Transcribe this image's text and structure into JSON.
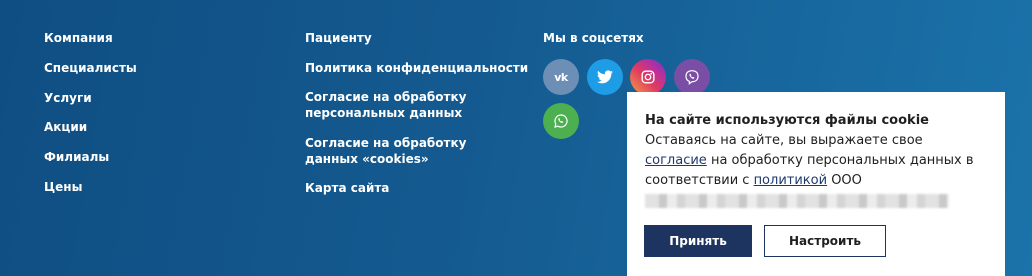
{
  "footer": {
    "company_links": [
      "Компания",
      "Специалисты",
      "Услуги",
      "Акции",
      "Филиалы",
      "Цены"
    ],
    "patient_links": [
      "Пациенту",
      "Политика конфиденциальности",
      "Согласие на обработку персональных данных",
      "Согласие на обработку данных «cookies»",
      "Карта сайта"
    ],
    "social": {
      "heading": "Мы в соцсетях",
      "icons": [
        "vk-icon",
        "twitter-icon",
        "instagram-icon",
        "viber-icon",
        "whatsapp-icon"
      ],
      "vk_glyph": "vk"
    },
    "colors": {
      "background": "#145a90",
      "vk": "#6d8fb6",
      "twitter": "#1e9de6",
      "viber": "#7b4ea5",
      "whatsapp": "#4caf50"
    }
  },
  "cookie_banner": {
    "title": "На сайте используются файлы cookie",
    "text_1": "Оставаясь на сайте, вы выражаете свое",
    "consent_link": "согласие",
    "text_2": " на обработку персональных данных в соответствии с ",
    "policy_link": "политикой",
    "text_3": " ООО",
    "accept_button": "Принять",
    "configure_button": "Настроить",
    "colors": {
      "accept_bg": "#1d3461",
      "link": "#1f3a6e"
    }
  }
}
